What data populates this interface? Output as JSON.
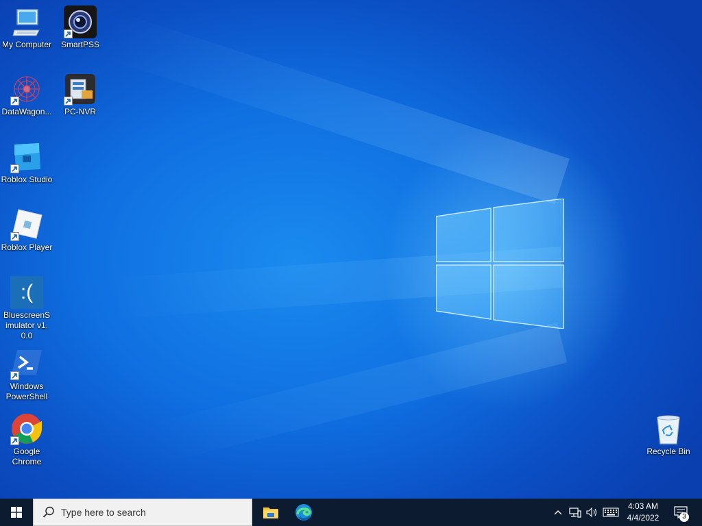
{
  "desktop": {
    "icons": [
      {
        "label": "My Computer"
      },
      {
        "label": "SmartPSS"
      },
      {
        "label": "DataWagon..."
      },
      {
        "label": "PC-NVR"
      },
      {
        "label": "Roblox Studio"
      },
      {
        "label": "Roblox Player"
      },
      {
        "label": "BluescreenSimulator v1.0.0"
      },
      {
        "label": "Windows PowerShell"
      },
      {
        "label": "Google Chrome"
      },
      {
        "label": "Recycle Bin"
      }
    ],
    "bsod_icon_text": ":("
  },
  "taskbar": {
    "search_placeholder": "Type here to search",
    "pinned": [
      "file-explorer",
      "microsoft-edge"
    ],
    "clock_time": "4:03 AM",
    "clock_date": "4/4/2022",
    "notification_count": "3"
  },
  "colors": {
    "taskbar": "#0d1b31",
    "desktop_accent": "#0f6fe0"
  }
}
